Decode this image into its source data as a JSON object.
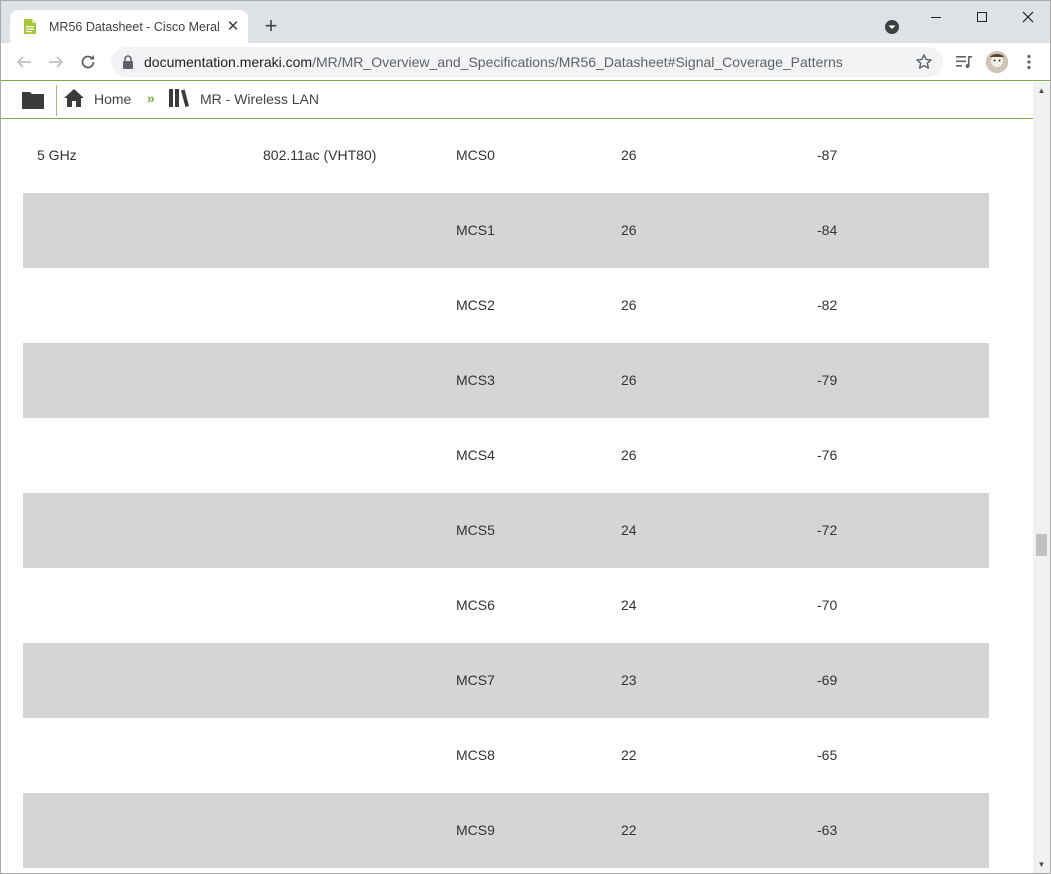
{
  "browser": {
    "tab_title": "MR56 Datasheet - Cisco Meraki",
    "url_host": "documentation.meraki.com",
    "url_path": "/MR/MR_Overview_and_Specifications/MR56_Datasheet#Signal_Coverage_Patterns",
    "icons": {
      "favicon": "document-icon",
      "close": "close-icon",
      "new_tab": "plus-icon",
      "back": "arrow-left-icon",
      "forward": "arrow-right-icon",
      "reload": "reload-icon",
      "lock": "lock-icon",
      "star": "star-icon",
      "reading_list": "reading-list-icon",
      "menu": "kebab-menu-icon"
    }
  },
  "site_nav": {
    "home_label": "Home",
    "separator": "»",
    "section_label": "MR - Wireless LAN",
    "accent_color": "#7cad4a"
  },
  "table": {
    "rows": [
      {
        "band": "5 GHz",
        "standard": "802.11ac (VHT80)",
        "rate": "MCS0",
        "power": "26",
        "sensitivity": "-87"
      },
      {
        "band": "",
        "standard": "",
        "rate": "MCS1",
        "power": "26",
        "sensitivity": "-84"
      },
      {
        "band": "",
        "standard": "",
        "rate": "MCS2",
        "power": "26",
        "sensitivity": "-82"
      },
      {
        "band": "",
        "standard": "",
        "rate": "MCS3",
        "power": "26",
        "sensitivity": "-79"
      },
      {
        "band": "",
        "standard": "",
        "rate": "MCS4",
        "power": "26",
        "sensitivity": "-76"
      },
      {
        "band": "",
        "standard": "",
        "rate": "MCS5",
        "power": "24",
        "sensitivity": "-72"
      },
      {
        "band": "",
        "standard": "",
        "rate": "MCS6",
        "power": "24",
        "sensitivity": "-70"
      },
      {
        "band": "",
        "standard": "",
        "rate": "MCS7",
        "power": "23",
        "sensitivity": "-69"
      },
      {
        "band": "",
        "standard": "",
        "rate": "MCS8",
        "power": "22",
        "sensitivity": "-65"
      },
      {
        "band": "",
        "standard": "",
        "rate": "MCS9",
        "power": "22",
        "sensitivity": "-63"
      }
    ],
    "shaded_color": "#d5d5d5"
  }
}
